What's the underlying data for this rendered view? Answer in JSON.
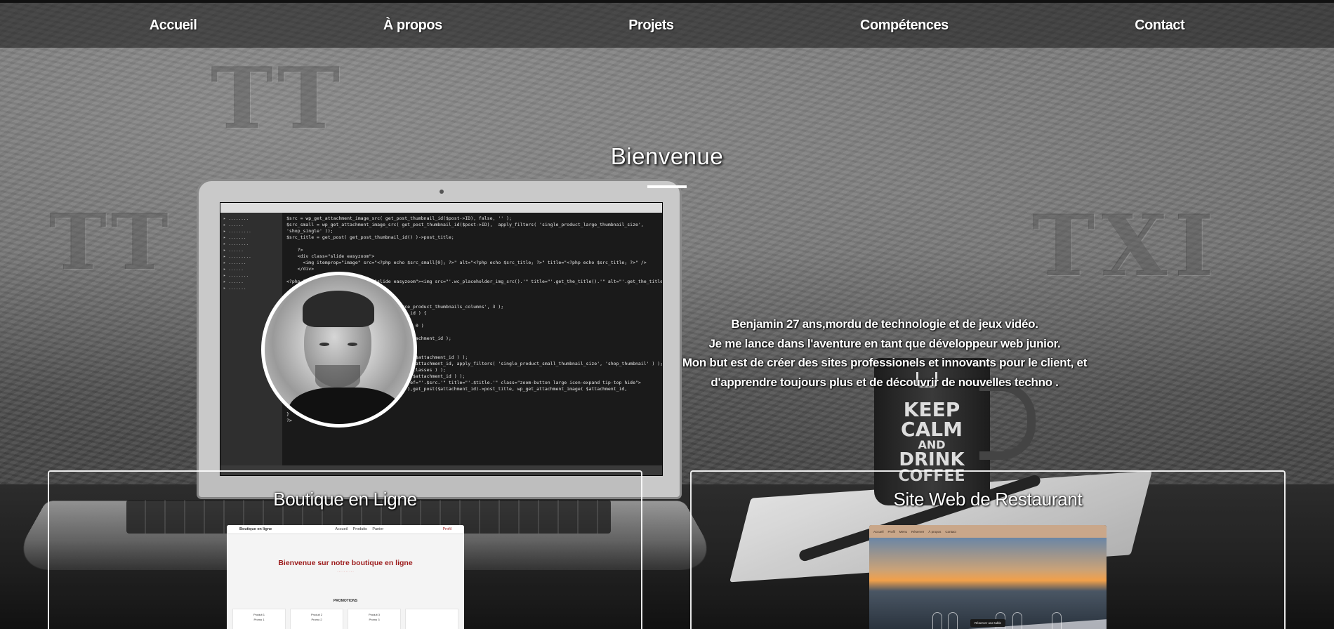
{
  "nav": {
    "items": [
      "Accueil",
      "À propos",
      "Projets",
      "Compétences",
      "Contact"
    ]
  },
  "hero": {
    "title": "Bienvenue",
    "bio": [
      "Benjamin 27 ans,mordu de technologie et de jeux vidéo.",
      "Je me lance dans l'aventure en tant que développeur web junior.",
      "Mon but est de créer des sites professionels et innovants pour le client, et",
      "d'apprendre toujours plus et de découvrir de nouvelles techno ."
    ]
  },
  "background": {
    "carved_text": [
      "TT",
      "TXI",
      "TT"
    ],
    "mug_text": [
      "KEEP",
      "CALM",
      "AND",
      "DRINK",
      "COFFEE"
    ]
  },
  "projects": [
    {
      "title": "Boutique en Ligne",
      "preview": {
        "brand": "Boutique en ligne",
        "links": [
          "Accueil",
          "Produits",
          "Panier"
        ],
        "account": "Profil",
        "hero_title": "Bienvenue sur notre boutique en ligne",
        "section_title": "PROMOTIONS",
        "products": [
          [
            "Produit 1",
            "Promo 1"
          ],
          [
            "Produit 2",
            "Promo 2"
          ],
          [
            "Produit 3",
            "Promo 3"
          ],
          [
            "",
            ""
          ]
        ]
      }
    },
    {
      "title": "Site Web de Restaurant",
      "preview": {
        "nav": [
          "Accueil",
          "Profil",
          "Menu",
          "Réserver",
          "À propos",
          "Contact"
        ],
        "cta": "Réserver une table"
      }
    }
  ],
  "colors": {
    "nav_bg": "#141414",
    "shop_accent": "#9b1a1a",
    "resto_bar": "#c9a78a"
  }
}
